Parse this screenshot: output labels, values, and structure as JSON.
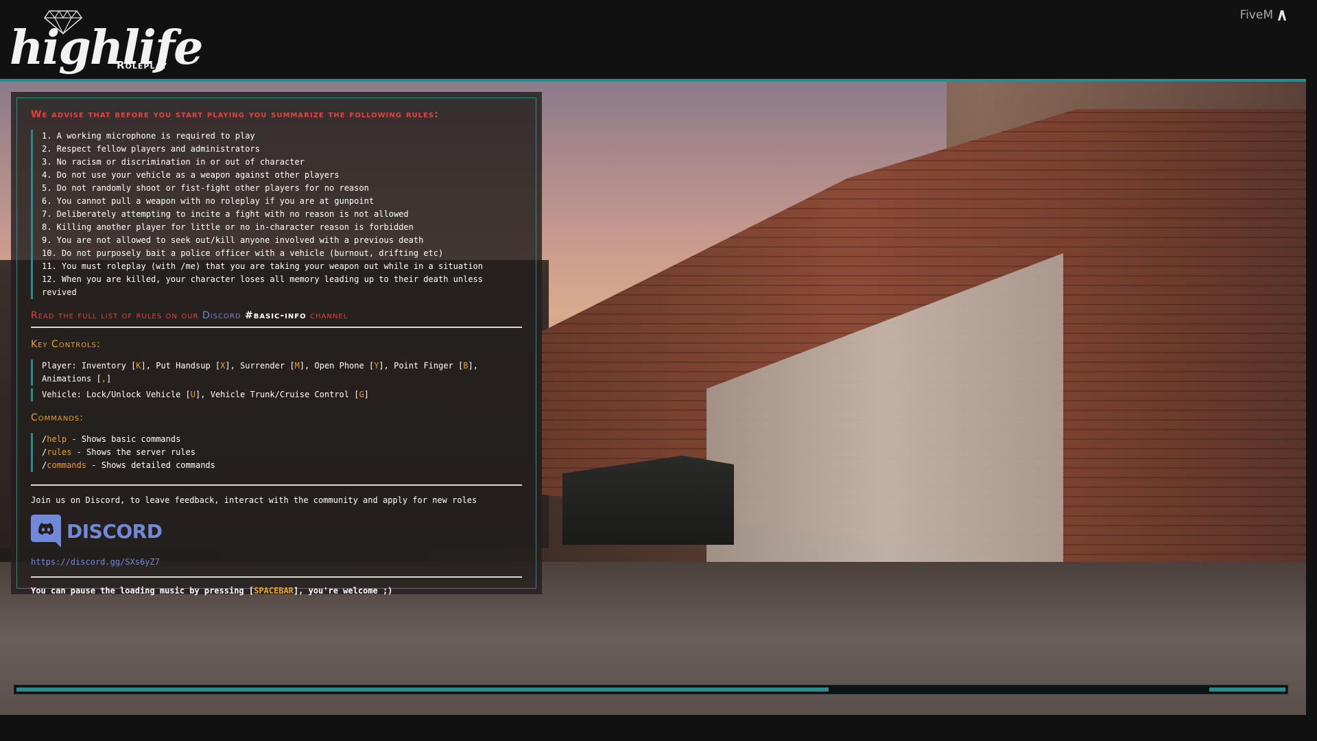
{
  "header": {
    "logo_text": "highlife",
    "logo_sub": "Roleplay",
    "client_name": "FiveM",
    "client_icon": "fivem-icon"
  },
  "rules": {
    "heading": "We advise that before you start playing you summarize the following rules:",
    "items": [
      "1. A working microphone is required to play",
      "2. Respect fellow players and administrators",
      "3. No racism or discrimination in or out of character",
      "4. Do not use your vehicle as a weapon against other players",
      "5. Do not randomly shoot or fist-fight other players for no reason",
      "6. You cannot pull a weapon with no roleplay if you are at gunpoint",
      "7. Deliberately attempting to incite a fight with no reason is not allowed",
      "8. Killing another player for little or no in-character reason is forbidden",
      "9. You are not allowed to seek out/kill anyone involved with a previous death",
      "10. Do not purposely bait a police officer with a vehicle (burnout, drifting etc)",
      "11. You must roleplay (with /me) that you are taking your weapon out while in a situation",
      "12. When you are killed, your character loses all memory leading up to their death unless revived"
    ],
    "read_more_prefix": "Read the full list of rules on our",
    "read_more_discord": "Discord",
    "read_more_channel": "#basic-info",
    "read_more_suffix": "channel"
  },
  "controls": {
    "heading": "Key Controls:",
    "player_label": "Player:",
    "player_items": [
      {
        "name": "Inventory",
        "key": "K"
      },
      {
        "name": "Put Handsup",
        "key": "X"
      },
      {
        "name": "Surrender",
        "key": "M"
      },
      {
        "name": "Open Phone",
        "key": "Y"
      },
      {
        "name": "Point Finger",
        "key": "B"
      },
      {
        "name": "Animations",
        "key": ","
      }
    ],
    "vehicle_label": "Vehicle:",
    "vehicle_items": [
      {
        "name": "Lock/Unlock Vehicle",
        "key": "U"
      },
      {
        "name": "Vehicle Trunk/Cruise Control",
        "key": "G"
      }
    ]
  },
  "commands": {
    "heading": "Commands:",
    "items": [
      {
        "cmd": "help",
        "desc": "- Shows basic commands"
      },
      {
        "cmd": "rules",
        "desc": "- Shows the server rules"
      },
      {
        "cmd": "commands",
        "desc": "- Shows detailed commands"
      }
    ]
  },
  "discord": {
    "join_text": "Join us on Discord, to leave feedback, interact with the community and apply for new roles",
    "logo_text": "DISCORD",
    "link": "https://discord.gg/SXs6yZ7"
  },
  "footer_note": {
    "prefix": "You can pause the loading music by pressing [",
    "key": "SPACEBAR",
    "suffix": "], you're welcome ;)"
  },
  "loading": {
    "progress": 0.64,
    "segment_start": 0.94,
    "segment_end": 1.0
  },
  "colors": {
    "accent": "#2a8a8e",
    "rules_red": "#e8403a",
    "key_orange": "#f0a020",
    "discord_blue": "#7289da"
  }
}
